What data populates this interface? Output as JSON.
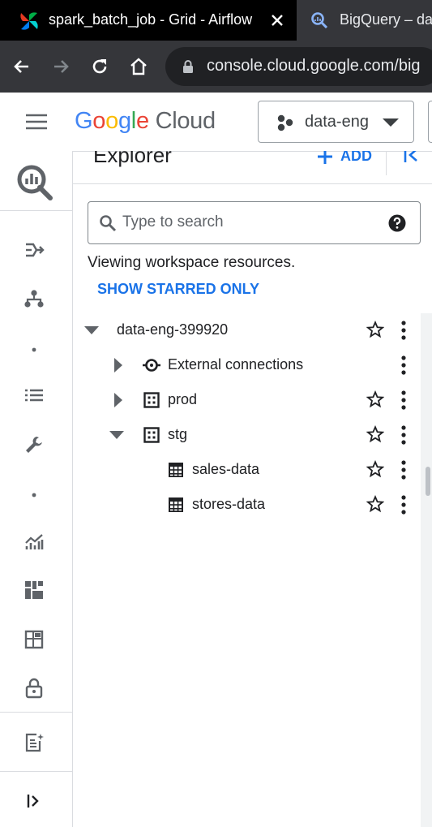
{
  "browser": {
    "tabs": [
      {
        "title": "spark_batch_job - Grid - Airflow",
        "active": true
      },
      {
        "title": "BigQuery – dat",
        "active": false
      }
    ],
    "url": "console.cloud.google.com/big"
  },
  "header": {
    "logo_google": [
      "G",
      "o",
      "o",
      "g",
      "l",
      "e"
    ],
    "logo_cloud": "Cloud",
    "logo_colors": [
      "#4285f4",
      "#ea4335",
      "#fbbc04",
      "#4285f4",
      "#34a853",
      "#ea4335"
    ],
    "project": "data-eng"
  },
  "rail": {
    "icons": [
      "bigquery-icon",
      "pipeline-icon",
      "hierarchy-icon",
      "dot-separator",
      "list-icon",
      "wrench-icon",
      "dot-separator",
      "analytics-icon",
      "dashboard-icon",
      "grid-icon",
      "lock-icon",
      "notes-icon",
      "expand-icon"
    ]
  },
  "explorer": {
    "title": "Explorer",
    "add_label": "ADD",
    "search_placeholder": "Type to search",
    "viewing_text": "Viewing workspace resources.",
    "starred_label": "SHOW STARRED ONLY",
    "tree": [
      {
        "label": "data-eng-399920",
        "level": 0,
        "expanded": true,
        "icon": "none",
        "starrable": true
      },
      {
        "label": "External connections",
        "level": 1,
        "expanded": false,
        "icon": "connection-icon",
        "starrable": false
      },
      {
        "label": "prod",
        "level": 1,
        "expanded": false,
        "icon": "dataset-icon",
        "starrable": true
      },
      {
        "label": "stg",
        "level": 1,
        "expanded": true,
        "icon": "dataset-icon",
        "starrable": true
      },
      {
        "label": "sales-data",
        "level": 2,
        "icon": "table-icon",
        "starrable": true
      },
      {
        "label": "stores-data",
        "level": 2,
        "icon": "table-icon",
        "starrable": true
      }
    ]
  },
  "colors": {
    "accent": "#1a73e8",
    "text": "#202124",
    "icon": "#5f6368"
  }
}
